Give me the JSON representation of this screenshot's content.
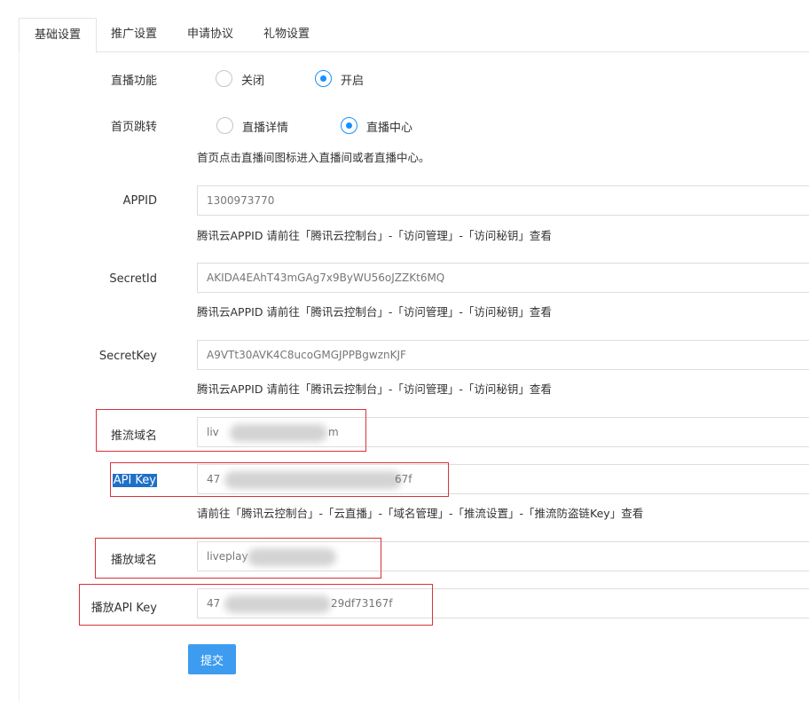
{
  "tabs": [
    "基础设置",
    "推广设置",
    "申请协议",
    "礼物设置"
  ],
  "live_function": {
    "label": "直播功能",
    "options": [
      "关闭",
      "开启"
    ],
    "selected": "开启"
  },
  "home_jump": {
    "label": "首页跳转",
    "options": [
      "直播详情",
      "直播中心"
    ],
    "selected": "直播中心",
    "help": "首页点击直播间图标进入直播间或者直播中心。"
  },
  "appid": {
    "label": "APPID",
    "value": "1300973770",
    "help": "腾讯云APPID 请前往「腾讯云控制台」-「访问管理」-「访问秘钥」查看"
  },
  "secretid": {
    "label": "SecretId",
    "value": "AKIDA4EAhT43mGAg7x9ByWU56oJZZKt6MQ",
    "help": "腾讯云APPID 请前往「腾讯云控制台」-「访问管理」-「访问秘钥」查看"
  },
  "secretkey": {
    "label": "SecretKey",
    "value": "A9VTt30AVK4C8ucoGMGJPPBgwznKJF",
    "help": "腾讯云APPID 请前往「腾讯云控制台」-「访问管理」-「访问秘钥」查看"
  },
  "push_domain": {
    "label": "推流域名",
    "value_start": "liv",
    "value_end": "m"
  },
  "api_key": {
    "label": "API Key",
    "value_start": "47",
    "value_end": "67f",
    "help": "请前往「腾讯云控制台」-「云直播」-「域名管理」-「推流设置」-「推流防盗链Key」查看"
  },
  "play_domain": {
    "label": "播放域名",
    "value_start": "liveplay"
  },
  "play_api_key": {
    "label": "播放API Key",
    "value_start": "47",
    "value_end": "29df73167f"
  },
  "submit_label": "提交",
  "colors": {
    "accent": "#1890ff",
    "button": "#3d9cf0",
    "highlight_box": "#d9323a"
  }
}
